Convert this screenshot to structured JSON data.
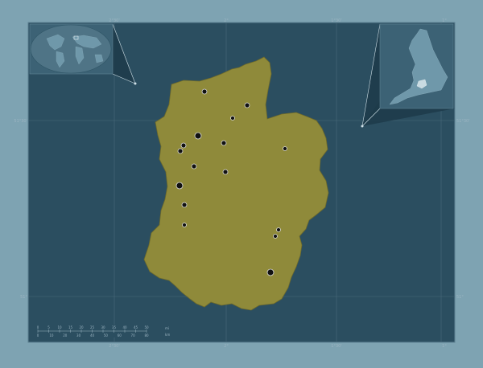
{
  "colors": {
    "outer_background": "#7ea3b2",
    "map_background": "#2b4e60",
    "graticule": "#4a6a7a",
    "region_fill": "#8f8a3a",
    "region_stroke": "#6f6a2a",
    "city_marker": "#111111",
    "inset_background": "#3c6275",
    "inset_land": "#6f98aa",
    "inset_highlight": "#c9dbe2",
    "frame_line": "#1d3b4a"
  },
  "graticule_labels": {
    "longitude_top": [
      "2°30'",
      "2°",
      "1°30'",
      "1°"
    ],
    "longitude_bottom": [
      "2°30'",
      "2°",
      "1°30'",
      "1°"
    ],
    "latitude_left": [
      "51°30'",
      "51°"
    ],
    "latitude_right": [
      "51°30'",
      "51°"
    ]
  },
  "scale_bar": {
    "top_labels": [
      "0",
      "5",
      "10",
      "15",
      "20",
      "25",
      "30",
      "35",
      "40",
      "45",
      "50"
    ],
    "top_unit": "mi",
    "bottom_labels": [
      "0",
      "10",
      "20",
      "30",
      "40",
      "50",
      "60",
      "70",
      "80"
    ],
    "bottom_unit": "km"
  },
  "insets": {
    "world": {
      "icon": "world-globe-inset"
    },
    "country": {
      "icon": "england-locator-inset"
    }
  }
}
